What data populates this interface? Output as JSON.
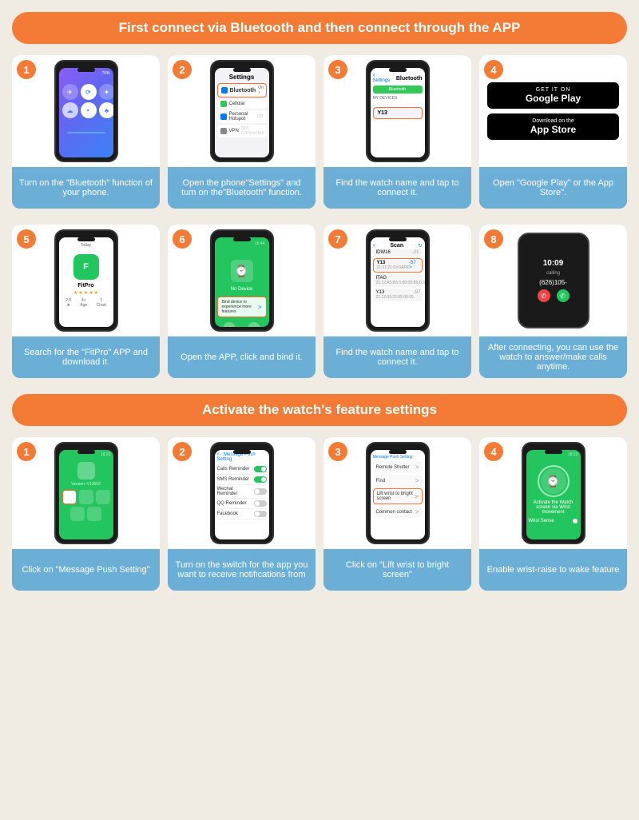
{
  "section1": {
    "header": "First connect via Bluetooth and then connect through the APP",
    "steps": [
      {
        "number": "1",
        "desc": "Turn on the \"Bluetooth\" function of your phone."
      },
      {
        "number": "2",
        "desc": "Open the phone\"Settings\" and tum on the\"Bluetooth\" function."
      },
      {
        "number": "3",
        "desc": "Find the watch name and tap to connect it."
      },
      {
        "number": "4",
        "desc": "Open \"Google Play\" or the App Store\"."
      },
      {
        "number": "5",
        "desc": "Search for the \"FitPro\" APP and download it."
      },
      {
        "number": "6",
        "desc": "Open the APP, click and bind it."
      },
      {
        "number": "7",
        "desc": "Find the watch name and tap to connect it."
      },
      {
        "number": "8",
        "desc": "After connecting, you can use the watch to answer/make calls anytime."
      }
    ],
    "google_play": "GET IT ON Google Play",
    "app_store": "Download on the App Store",
    "fitpro": "FitPro",
    "settings_title": "Settings",
    "bluetooth_label": "Bluetooth",
    "bluetooth_on": "On",
    "watch_name": "Y13",
    "scan_title": "Scan",
    "bind_text": "Bind device to experience more features",
    "no_device": "No Device",
    "calling_number": "(626)105-",
    "calling_text": "calling",
    "time_display": "10:09"
  },
  "section2": {
    "header": "Activate the watch's feature settings",
    "steps": [
      {
        "number": "1",
        "desc": "Click on \"Message Push Setting\""
      },
      {
        "number": "2",
        "desc": "Turn on the switch for the app you want to receive notifications from"
      },
      {
        "number": "3",
        "desc": "Click on \"Lift wrist to bright screen\""
      },
      {
        "number": "4",
        "desc": "Enable wrist-raise to wake feature"
      }
    ],
    "msg_push": "Message Push Setting",
    "calls_reminder": "Calls Reminder",
    "sms_reminder": "SMS Reminder",
    "wechat_reminder": "Wechat Reminder",
    "qq_reminder": "QQ Reminder",
    "facebook": "Facebook",
    "lift_wrist": "Lift wrist to bright screen",
    "common_contact": "Common contact",
    "wrist_sense": "Wrist Sense",
    "remote_shutter": "Remote Shutter",
    "find": "Find",
    "version": "Version: V13653"
  }
}
